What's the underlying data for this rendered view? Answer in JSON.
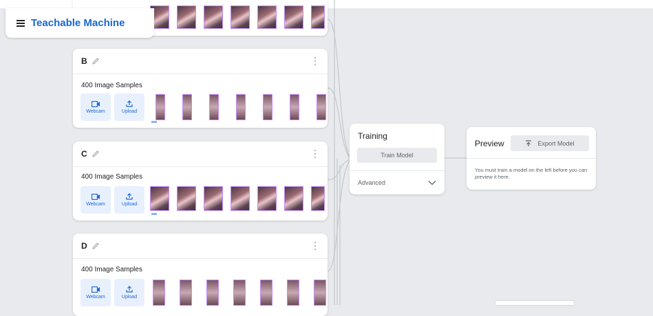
{
  "app": {
    "title": "Teachable Machine"
  },
  "classes": [
    {
      "name": "B",
      "samples_label": "400 Image Samples",
      "webcam_label": "Webcam",
      "upload_label": "Upload"
    },
    {
      "name": "C",
      "samples_label": "400 Image Samples",
      "webcam_label": "Webcam",
      "upload_label": "Upload"
    },
    {
      "name": "D",
      "samples_label": "400 Image Samples",
      "webcam_label": "Webcam",
      "upload_label": "Upload"
    }
  ],
  "training": {
    "title": "Training",
    "train_button": "Train Model",
    "advanced_label": "Advanced"
  },
  "preview": {
    "title": "Preview",
    "export_button": "Export Model",
    "message": "You must train a model on the left before you can preview it here."
  },
  "colors": {
    "accent": "#1967d2",
    "background": "#e8eaed",
    "button_bg": "#e8f0fe"
  }
}
